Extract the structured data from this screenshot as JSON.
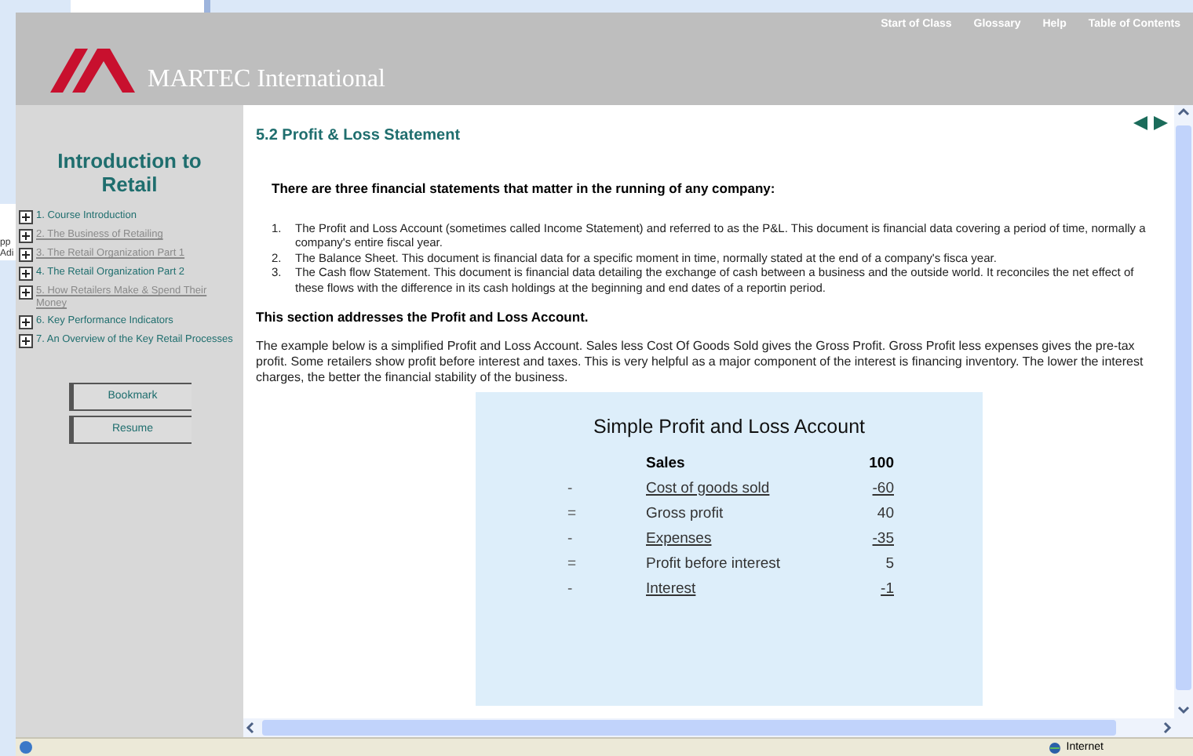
{
  "background_window": {
    "fragments": [
      "pp",
      "Adi"
    ]
  },
  "header": {
    "logo_text": "MARTEC International",
    "nav": [
      "Start of Class",
      "Glossary",
      "Help",
      "Table of Contents"
    ]
  },
  "sidebar": {
    "title": "Introduction to Retail",
    "items": [
      {
        "label": "1. Course Introduction",
        "visited": false
      },
      {
        "label": "2. The Business of Retailing",
        "visited": true
      },
      {
        "label": "3. The Retail Organization Part 1",
        "visited": true
      },
      {
        "label": "4. The Retail Organization Part 2",
        "visited": false
      },
      {
        "label": "5. How Retailers Make & Spend Their Money",
        "visited": true
      },
      {
        "label": "6. Key Performance Indicators",
        "visited": false
      },
      {
        "label": "7. An Overview of the Key Retail Processes",
        "visited": false
      }
    ],
    "buttons": [
      "Bookmark",
      "Resume"
    ]
  },
  "content": {
    "title": "5.2 Profit & Loss Statement",
    "intro": "There are three financial statements that matter in the running of any company:",
    "list": [
      {
        "number": "1.",
        "text": "The Profit and Loss Account (sometimes called Income Statement) and referred to as the P&L. This document is financial data covering a period of time, normally a company's entire fiscal year."
      },
      {
        "number": "2.",
        "text": "The Balance Sheet. This document is financial data for a specific moment in time, normally stated at the end of a company's fisca year."
      },
      {
        "number": "3.",
        "text": "The Cash flow Statement. This document is financial data detailing the exchange of cash between a business and the outside world. It reconciles the net effect of these flows with the difference in its cash holdings at the beginning and end dates of a reportin period."
      }
    ],
    "section_heading": "This section addresses the Profit and Loss Account.",
    "paragraph": "The example below is a simplified Profit and Loss Account. Sales less Cost Of Goods Sold gives the Gross Profit. Gross Profit less expenses gives the pre-tax profit. Some retailers show profit before interest and taxes. This is very helpful as a major component of the interest is financing inventory. The lower the interest charges, the better the financial stability of the business.",
    "table": {
      "title": "Simple Profit and Loss Account",
      "rows": [
        {
          "kind": "header",
          "label": "Sales",
          "value": "100"
        },
        {
          "kind": "link",
          "operator": "-",
          "label": "Cost of goods sold",
          "value": "-60"
        },
        {
          "kind": "plain",
          "operator": "=",
          "label": "Gross profit",
          "value": "40"
        },
        {
          "kind": "link",
          "operator": "-",
          "label": "Expenses",
          "value": "-35"
        },
        {
          "kind": "plain",
          "operator": "=",
          "label": "Profit before interest",
          "value": "5"
        },
        {
          "kind": "link",
          "operator": "-",
          "label": "Interest",
          "value": "-1"
        }
      ]
    }
  },
  "status_bar": {
    "zone": "Internet"
  }
}
